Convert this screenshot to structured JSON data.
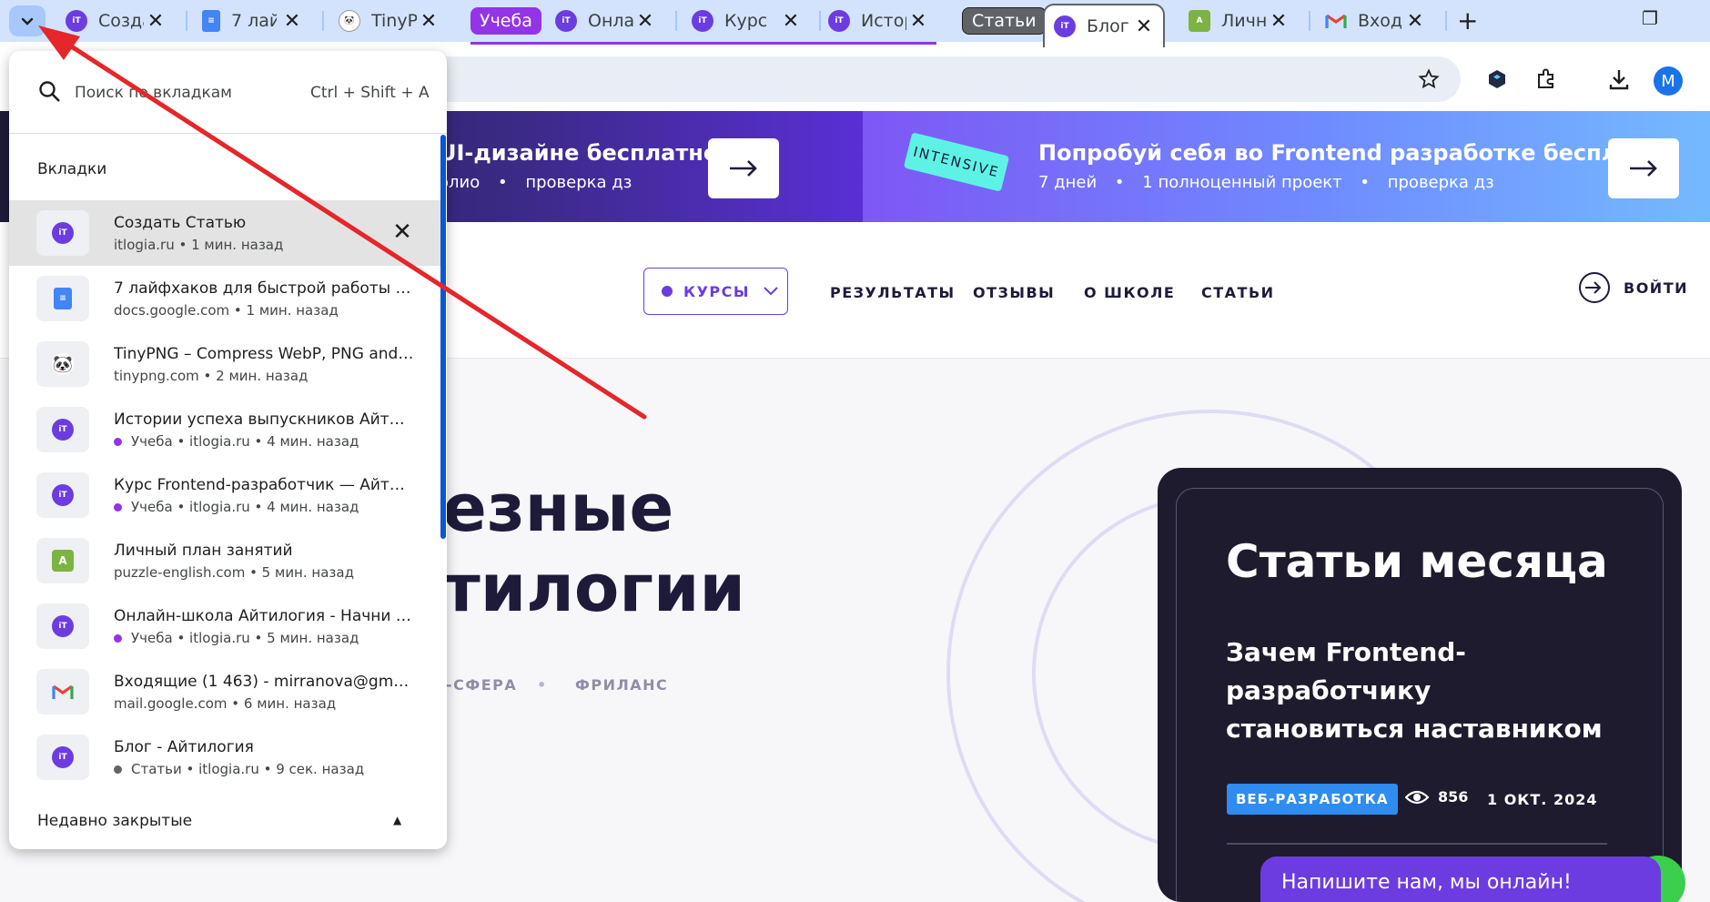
{
  "tabs": [
    {
      "title": "Созда",
      "favicon": "itlogia-icon"
    },
    {
      "title": "7 лай",
      "favicon": "google-docs-icon"
    },
    {
      "title": "TinyP",
      "favicon": "tinypng-panda-icon"
    },
    {
      "title": "Онла",
      "favicon": "itlogia-icon"
    },
    {
      "title": "Курс",
      "favicon": "itlogia-icon"
    },
    {
      "title": "Истор",
      "favicon": "itlogia-icon"
    },
    {
      "title": "Блог",
      "favicon": "itlogia-icon"
    },
    {
      "title": "Личн",
      "favicon": "puzzle-english-icon"
    },
    {
      "title": "Входя",
      "favicon": "gmail-icon"
    }
  ],
  "tab_groups": [
    {
      "label": "Учеба",
      "color": "#9334e6"
    },
    {
      "label": "Статьи",
      "color": "#5f6368"
    }
  ],
  "avatar_letter": "M",
  "banner": {
    "left_title": "UI-дизайне бесплатно",
    "left_sub_1": "олио",
    "left_sub_2": "проверка дз",
    "intensive": "INTENSIVE",
    "right_title": "Попробуй себя во Frontend разработке бесплатно",
    "right_sub_1": "7 дней",
    "right_sub_2": "1 полноценный проект",
    "right_sub_3": "проверка дз"
  },
  "nav": {
    "courses": "КУРСЫ",
    "results": "РЕЗУЛЬТАТЫ",
    "reviews": "ОТЗЫВЫ",
    "about": "О ШКОЛЕ",
    "articles": "СТАТЬИ",
    "login": "ВОЙТИ"
  },
  "hero": {
    "line1": "езные",
    "line2": "тилогии",
    "tag1": "-СФЕРА",
    "tag2": "ФРИЛАНС"
  },
  "card": {
    "title": "Статьи месяца",
    "article": "Зачем Frontend-разработчику становиться наставником",
    "badge": "ВЕБ-РАЗРАБОТКА",
    "views": "856",
    "date": "1 ОКТ. 2024"
  },
  "chat": "Напишите нам, мы онлайн!",
  "dropdown": {
    "search_placeholder": "Поиск по вкладкам",
    "shortcut": "Ctrl + Shift + A",
    "section": "Вкладки",
    "recently_closed": "Недавно закрытые",
    "items": [
      {
        "title": "Создать Статью",
        "group": "",
        "sub": "itlogia.ru • 1 мин. назад",
        "favicon": "itlogia-icon"
      },
      {
        "title": "7 лайфхаков для быстрой работы в …",
        "group": "",
        "sub": "docs.google.com • 1 мин. назад",
        "favicon": "google-docs-icon"
      },
      {
        "title": "TinyPNG – Compress WebP, PNG and …",
        "group": "",
        "sub": "tinypng.com • 2 мин. назад",
        "favicon": "tinypng-panda-icon"
      },
      {
        "title": "Истории успеха выпускников Айти…",
        "group": "Учеба",
        "sub": "Учеба • itlogia.ru • 4 мин. назад",
        "favicon": "itlogia-icon"
      },
      {
        "title": "Курс Frontend-разработчик — Айти…",
        "group": "Учеба",
        "sub": "Учеба • itlogia.ru • 4 мин. назад",
        "favicon": "itlogia-icon"
      },
      {
        "title": "Личный план занятий",
        "group": "",
        "sub": "puzzle-english.com • 5 мин. назад",
        "favicon": "puzzle-english-icon"
      },
      {
        "title": "Онлайн-школа Айтилогия - Начни с…",
        "group": "Учеба",
        "sub": "Учеба • itlogia.ru • 5 мин. назад",
        "favicon": "itlogia-icon"
      },
      {
        "title": "Входящие (1 463) - mirranova@gmai…",
        "group": "",
        "sub": "mail.google.com • 6 мин. назад",
        "favicon": "gmail-icon"
      },
      {
        "title": "Блог - Айтилогия",
        "group": "Статьи",
        "sub": "Статьи • itlogia.ru • 9 сек. назад",
        "favicon": "itlogia-icon"
      }
    ]
  },
  "colors": {
    "accent": "#6c3ce1",
    "arrow": "#e5262a",
    "group_study": "#9334e6",
    "group_articles": "#5f6368"
  }
}
